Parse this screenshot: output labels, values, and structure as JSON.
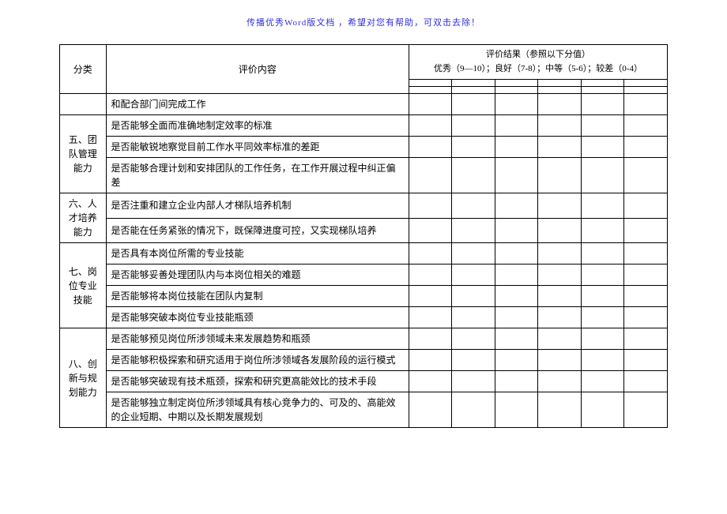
{
  "banner": "传播优秀Word版文档 ，希望对您有帮助，可双击去除！",
  "header": {
    "category": "分类",
    "content": "评价内容",
    "result_title": "评价结果（参照以下分值）",
    "result_scale": "优秀（9—10）；良好（7-8）；中等（5-6）；较差（0-4）"
  },
  "rows": [
    {
      "cat": "",
      "cat_rows": 1,
      "item": "和配合部门间完成工作"
    },
    {
      "cat": "五、团队管理能力",
      "cat_rows": 3,
      "item": "是否能够全面而准确地制定效率的标准"
    },
    {
      "cat": "",
      "cat_rows": 0,
      "item": "是否能敏锐地察觉目前工作水平同效率标准的差距"
    },
    {
      "cat": "",
      "cat_rows": 0,
      "item": "是否能够合理计划和安排团队的工作任务，在工作开展过程中纠正偏差"
    },
    {
      "cat": "六、人才培养能力",
      "cat_rows": 2,
      "item": "是否注重和建立企业内部人才梯队培养机制"
    },
    {
      "cat": "",
      "cat_rows": 0,
      "item": "是否能在任务紧张的情况下，既保障进度可控，又实现梯队培养"
    },
    {
      "cat": "七、岗位专业技能",
      "cat_rows": 4,
      "item": "是否具有本岗位所需的专业技能"
    },
    {
      "cat": "",
      "cat_rows": 0,
      "item": "是否能够妥善处理团队内与本岗位相关的难题"
    },
    {
      "cat": "",
      "cat_rows": 0,
      "item": "是否能够将本岗位技能在团队内复制"
    },
    {
      "cat": "",
      "cat_rows": 0,
      "item": "是否能够突破本岗位专业技能瓶颈"
    },
    {
      "cat": "八、创新与规划能力",
      "cat_rows": 4,
      "item": "是否能够预见岗位所涉领域未来发展趋势和瓶颈"
    },
    {
      "cat": "",
      "cat_rows": 0,
      "item": "是否能够积极探索和研究适用于岗位所涉领域各发展阶段的运行模式"
    },
    {
      "cat": "",
      "cat_rows": 0,
      "item": "是否能够突破现有技术瓶颈，探索和研究更高能效比的技术手段"
    },
    {
      "cat": "",
      "cat_rows": 0,
      "item": "是否能够独立制定岗位所涉领域具有核心竞争力的、可及的、高能效的企业短期、中期以及长期发展规划"
    }
  ]
}
